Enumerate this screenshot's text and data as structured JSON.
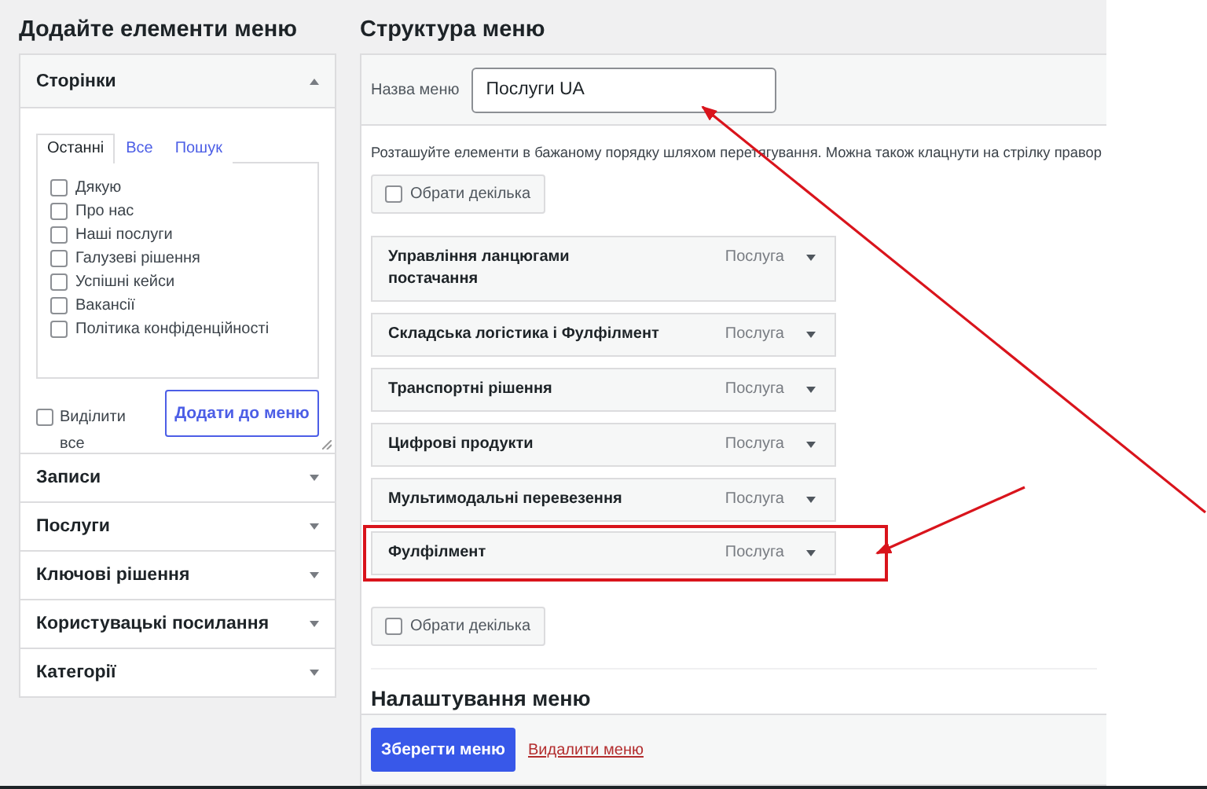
{
  "left": {
    "title": "Додайте елементи меню",
    "sections": [
      {
        "title": "Сторінки",
        "expanded": true
      },
      {
        "title": "Записи",
        "expanded": false
      },
      {
        "title": "Послуги",
        "expanded": false
      },
      {
        "title": "Ключові рішення",
        "expanded": false
      },
      {
        "title": "Користувацькі посилання",
        "expanded": false
      },
      {
        "title": "Категорії",
        "expanded": false
      }
    ],
    "pages_panel": {
      "tabs": [
        {
          "label": "Останні",
          "selected": true
        },
        {
          "label": "Все",
          "selected": false
        },
        {
          "label": "Пошук",
          "selected": false
        }
      ],
      "pages": [
        {
          "label": "Дякую",
          "checked": false
        },
        {
          "label": "Про нас",
          "checked": false
        },
        {
          "label": "Наші послуги",
          "checked": false
        },
        {
          "label": "Галузеві рішення",
          "checked": false
        },
        {
          "label": "Успішні кейси",
          "checked": false
        },
        {
          "label": "Вакансії",
          "checked": false
        },
        {
          "label": "Політика конфіденційності",
          "checked": false
        }
      ],
      "select_all": {
        "label": "Виділити все",
        "checked": false
      },
      "add_button": "Додати до меню"
    }
  },
  "right": {
    "title": "Структура меню",
    "menu_name": {
      "label": "Назва меню",
      "value": "Послуги UA"
    },
    "instructions": "Розташуйте елементи в бажаному порядку шляхом перетягування. Можна також клацнути на стрілку правор",
    "bulk_select_top": {
      "label": "Обрати декілька",
      "checked": false
    },
    "items": [
      {
        "title": "Управління ланцюгами\nпостачання",
        "type": "Послуга",
        "highlighted": false
      },
      {
        "title": "Складська логістика і Фулфілмент",
        "type": "Послуга",
        "highlighted": false
      },
      {
        "title": "Транспортні рішення",
        "type": "Послуга",
        "highlighted": false
      },
      {
        "title": "Цифрові продукти",
        "type": "Послуга",
        "highlighted": false
      },
      {
        "title": "Мультимодальні перевезення",
        "type": "Послуга",
        "highlighted": false
      },
      {
        "title": "Фулфілмент",
        "type": "Послуга",
        "highlighted": true
      }
    ],
    "bulk_select_bottom": {
      "label": "Обрати декілька",
      "checked": false
    },
    "settings_heading": "Налаштування меню",
    "save_button": "Зберегти меню",
    "delete_link": "Видалити меню"
  }
}
